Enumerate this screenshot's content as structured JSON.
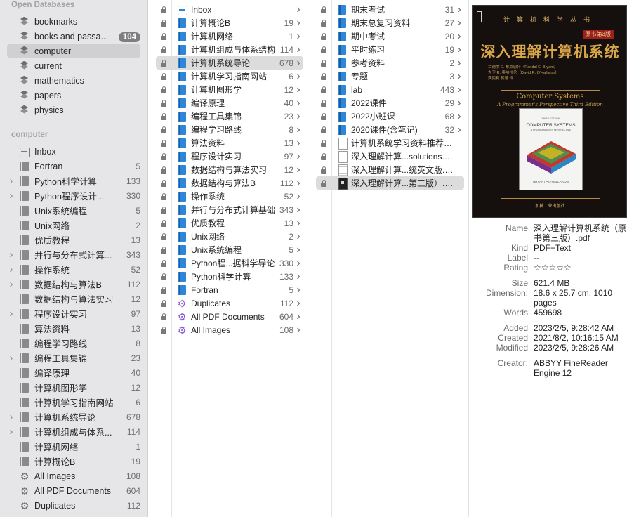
{
  "sidebar": {
    "open_databases_heading": "Open Databases",
    "databases": [
      {
        "label": "bookmarks",
        "count": ""
      },
      {
        "label": "books and passa...",
        "count": "104"
      },
      {
        "label": "computer",
        "count": ""
      },
      {
        "label": "current",
        "count": ""
      },
      {
        "label": "mathematics",
        "count": ""
      },
      {
        "label": "papers",
        "count": ""
      },
      {
        "label": "physics",
        "count": ""
      }
    ],
    "section_heading": "computer",
    "groups": [
      {
        "label": "Inbox",
        "count": ""
      },
      {
        "label": "Fortran",
        "count": "5"
      },
      {
        "label": "Python科学计算",
        "count": "133"
      },
      {
        "label": "Python程序设计...",
        "count": "330"
      },
      {
        "label": "Unix系统编程",
        "count": "5"
      },
      {
        "label": "Unix网络",
        "count": "2"
      },
      {
        "label": "优质教程",
        "count": "13"
      },
      {
        "label": "并行与分布式计算...",
        "count": "343"
      },
      {
        "label": "操作系统",
        "count": "52"
      },
      {
        "label": "数据结构与算法B",
        "count": "112"
      },
      {
        "label": "数据结构与算法实习",
        "count": "12"
      },
      {
        "label": "程序设计实习",
        "count": "97"
      },
      {
        "label": "算法资料",
        "count": "13"
      },
      {
        "label": "编程学习路线",
        "count": "8"
      },
      {
        "label": "编程工具集锦",
        "count": "23"
      },
      {
        "label": "编译原理",
        "count": "40"
      },
      {
        "label": "计算机图形学",
        "count": "12"
      },
      {
        "label": "计算机学习指南网站",
        "count": "6"
      },
      {
        "label": "计算机系统导论",
        "count": "678"
      },
      {
        "label": "计算机组成与体系...",
        "count": "114"
      },
      {
        "label": "计算机网络",
        "count": "1"
      },
      {
        "label": "计算概论B",
        "count": "19"
      },
      {
        "label": "All Images",
        "count": "108"
      },
      {
        "label": "All PDF Documents",
        "count": "604"
      },
      {
        "label": "Duplicates",
        "count": "112"
      }
    ]
  },
  "column1": [
    {
      "label": "Inbox",
      "count": ""
    },
    {
      "label": "计算概论B",
      "count": "19"
    },
    {
      "label": "计算机网络",
      "count": "1"
    },
    {
      "label": "计算机组成与体系结构",
      "count": "114"
    },
    {
      "label": "计算机系统导论",
      "count": "678"
    },
    {
      "label": "计算机学习指南网站",
      "count": "6"
    },
    {
      "label": "计算机图形学",
      "count": "12"
    },
    {
      "label": "编译原理",
      "count": "40"
    },
    {
      "label": "编程工具集锦",
      "count": "23"
    },
    {
      "label": "编程学习路线",
      "count": "8"
    },
    {
      "label": "算法资料",
      "count": "13"
    },
    {
      "label": "程序设计实习",
      "count": "97"
    },
    {
      "label": "数据结构与算法实习",
      "count": "12"
    },
    {
      "label": "数据结构与算法B",
      "count": "112"
    },
    {
      "label": "操作系统",
      "count": "52"
    },
    {
      "label": "并行与分布式计算基础",
      "count": "343"
    },
    {
      "label": "优质教程",
      "count": "13"
    },
    {
      "label": "Unix网络",
      "count": "2"
    },
    {
      "label": "Unix系统编程",
      "count": "5"
    },
    {
      "label": "Python程...据科学导论",
      "count": "330"
    },
    {
      "label": "Python科学计算",
      "count": "133"
    },
    {
      "label": "Fortran",
      "count": "5"
    },
    {
      "label": "Duplicates",
      "count": "112"
    },
    {
      "label": "All PDF Documents",
      "count": "604"
    },
    {
      "label": "All Images",
      "count": "108"
    }
  ],
  "column2": [
    {
      "label": "期末考试",
      "count": "31"
    },
    {
      "label": "期末总复习资料",
      "count": "27"
    },
    {
      "label": "期中考试",
      "count": "20"
    },
    {
      "label": "平时练习",
      "count": "19"
    },
    {
      "label": "参考资料",
      "count": "2"
    },
    {
      "label": "专题",
      "count": "3"
    },
    {
      "label": "lab",
      "count": "443"
    },
    {
      "label": "2022课件",
      "count": "29"
    },
    {
      "label": "2022小班课",
      "count": "68"
    },
    {
      "label": "2020课件(含笔记)",
      "count": "32"
    },
    {
      "label": "计算机系统学习资料推荐.pdf",
      "count": ""
    },
    {
      "label": "深入理解计算...solutions.pdf",
      "count": ""
    },
    {
      "label": "深入理解计算...统英文版.pdf",
      "count": ""
    },
    {
      "label": "深入理解计算...第三版）.pdf",
      "count": ""
    }
  ],
  "cover": {
    "series": "计算机科学丛书",
    "badge": "原书第3版",
    "title": "深入理解计算机系统",
    "authors_line1": "兰德尔 E. 布莱恩特（Randal E. Bryant）",
    "authors_line2": "大卫 R. 奥哈拉伦（David R. O'Hallaron）",
    "translators": "龚奕利 贺莲 译",
    "en_title": "Computer Systems",
    "en_subtitle": "A Programmer's Perspective  Third Edition",
    "inner_edition": "THIRD EDITION",
    "inner_title": "COMPUTER SYSTEMS",
    "inner_subtitle": "A PROGRAMMER'S PERSPECTIVE",
    "inner_authors": "BRYANT • O'HALLARON",
    "publisher": "机械工业出版社"
  },
  "info": {
    "name_label": "Name",
    "name_value": "深入理解计算机系统（原书第三版）.pdf",
    "kind_label": "Kind",
    "kind_value": "PDF+Text",
    "label_label": "Label",
    "label_value": "--",
    "rating_label": "Rating",
    "rating_value": "☆☆☆☆☆",
    "size_label": "Size",
    "size_value": "621.4 MB",
    "dimension_label": "Dimension:",
    "dimension_value": "18.6 x 25.7 cm, 1010 pages",
    "words_label": "Words",
    "words_value": "459698",
    "added_label": "Added",
    "added_value": "2023/2/5, 9:28:42 AM",
    "created_label": "Created",
    "created_value": "2021/8/2, 10:16:15 AM",
    "modified_label": "Modified",
    "modified_value": "2023/2/5, 9:28:26 AM",
    "creator_label": "Creator:",
    "creator_value": "ABBYY FineReader Engine 12"
  }
}
